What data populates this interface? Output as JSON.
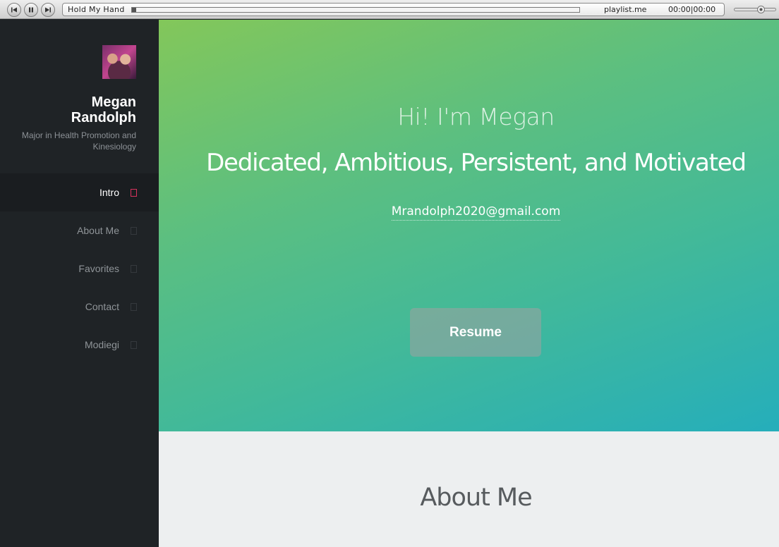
{
  "player": {
    "track_title": "Hold My Hand",
    "playlist_link": "playlist.me",
    "time": "00:00|00:00",
    "progress": 0.0,
    "volume": 0.55,
    "icons": [
      "previous-icon",
      "pause-icon",
      "next-icon"
    ]
  },
  "sidebar": {
    "name": "Megan Randolph",
    "tagline": "Major in Health Promotion and Kinesiology",
    "nav": [
      {
        "label": "Intro",
        "active": true
      },
      {
        "label": "About Me",
        "active": false
      },
      {
        "label": "Favorites",
        "active": false
      },
      {
        "label": "Contact",
        "active": false
      },
      {
        "label": "Modiegi",
        "active": false
      }
    ],
    "accent_color": "#d9325d"
  },
  "hero": {
    "greeting": "Hi! I'm Megan",
    "subtitle": "Dedicated, Ambitious, Persistent, and Motivated",
    "email": "Mrandolph2020@gmail.com",
    "resume_label": "Resume",
    "gradient_colors": [
      "#83c75a",
      "#25aebb"
    ]
  },
  "about": {
    "title": "About Me"
  }
}
